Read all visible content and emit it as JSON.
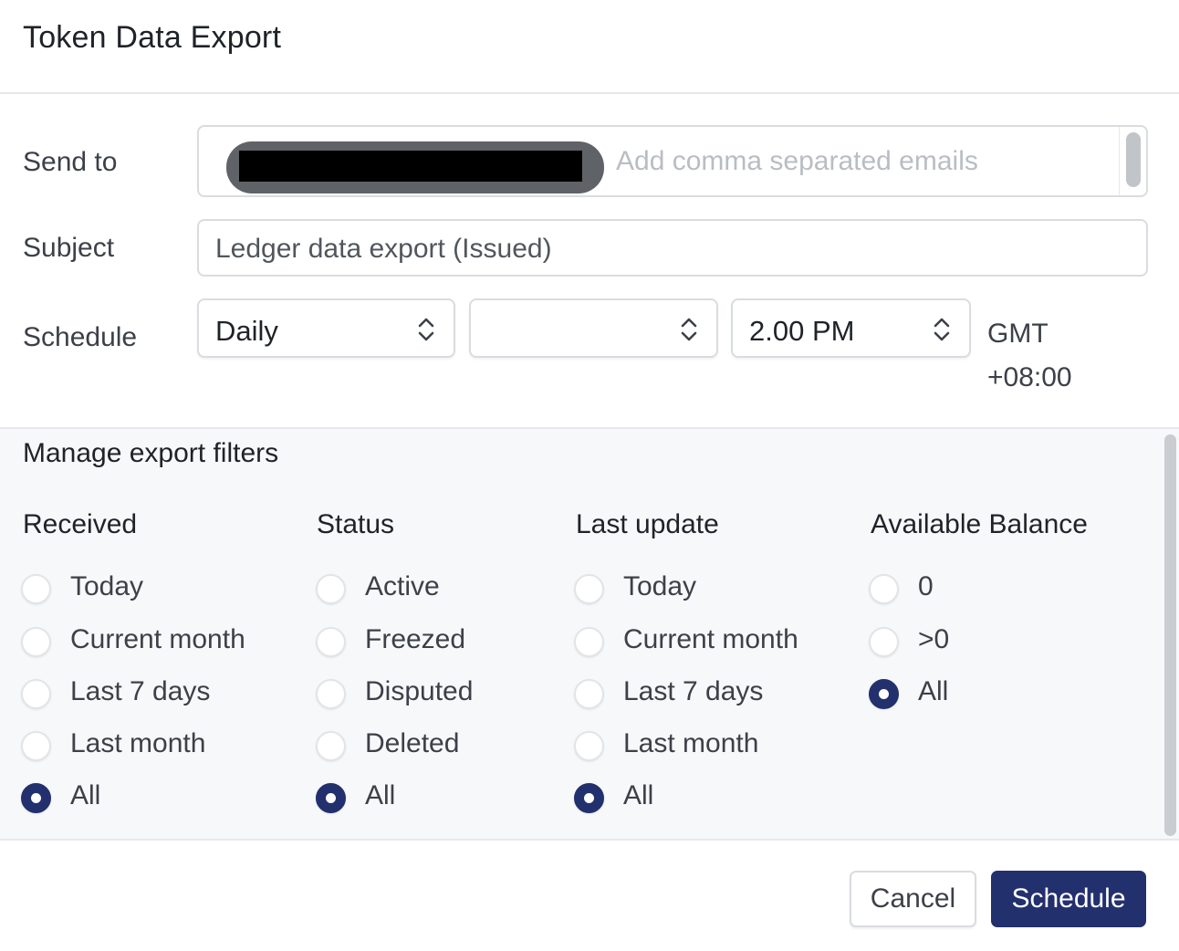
{
  "dialog": {
    "title": "Token Data Export"
  },
  "send_to": {
    "label": "Send to",
    "placeholder": "Add comma separated emails"
  },
  "subject": {
    "label": "Subject",
    "value": "Ledger data export (Issued)"
  },
  "schedule": {
    "label": "Schedule",
    "frequency": "Daily",
    "day": "",
    "time": "2.00 PM",
    "timezone_line1": "GMT",
    "timezone_line2": "+08:00"
  },
  "filters": {
    "title": "Manage export filters",
    "groups": [
      {
        "heading": "Received",
        "options": [
          "Today",
          "Current month",
          "Last 7 days",
          "Last month",
          "All"
        ],
        "selected": "All"
      },
      {
        "heading": "Status",
        "options": [
          "Active",
          "Freezed",
          "Disputed",
          "Deleted",
          "All"
        ],
        "selected": "All"
      },
      {
        "heading": "Last update",
        "options": [
          "Today",
          "Current month",
          "Last 7 days",
          "Last month",
          "All"
        ],
        "selected": "All"
      },
      {
        "heading": "Available Balance",
        "options": [
          "0",
          ">0",
          "All"
        ],
        "selected": "All"
      }
    ]
  },
  "actions": {
    "cancel_label": "Cancel",
    "schedule_label": "Schedule"
  },
  "colors": {
    "primary": "#23306e",
    "border": "#d9dce0",
    "panel_bg": "#f7f8fa"
  }
}
